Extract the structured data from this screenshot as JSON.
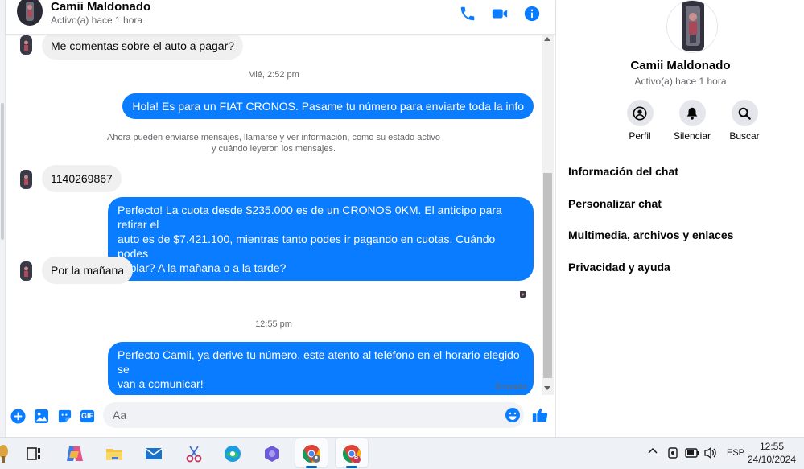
{
  "header": {
    "contact_name": "Camii Maldonado",
    "status": "Activo(a) hace 1 hora",
    "icons": [
      "phone-icon",
      "video-icon",
      "info-icon"
    ]
  },
  "messages": [
    {
      "direction": "in",
      "text": "Me comentas sobre el auto a pagar?"
    },
    {
      "type": "timestamp",
      "text": "Mié, 2:52 pm"
    },
    {
      "direction": "out",
      "text": "Hola! Es para un FIAT CRONOS. Pasame tu número para enviarte toda la info"
    },
    {
      "type": "system",
      "line1": "Ahora pueden enviarse mensajes, llamarse y ver información, como su estado activo",
      "line2": "y cuándo leyeron los mensajes."
    },
    {
      "direction": "in",
      "text": "1140269867"
    },
    {
      "direction": "out",
      "line1": "Perfecto! La cuota desde $235.000 es de un CRONOS 0KM. El anticipo para retirar el",
      "line2": "auto es de $7.421.100, mientras tanto podes ir pagando en cuotas. Cuándo podes",
      "line3": "hablar? A la mañana o a la tarde?"
    },
    {
      "direction": "in",
      "text": "Por la mañana"
    },
    {
      "type": "timestamp",
      "text": "12:55 pm"
    },
    {
      "direction": "out",
      "line1": "Perfecto Camii, ya derive tu número, este atento al teléfono en el horario elegido se",
      "line2": "van a comunicar!"
    }
  ],
  "sent_label": "Enviado",
  "composer": {
    "placeholder": "Aa",
    "value": "",
    "icons": [
      "plus-icon",
      "image-icon",
      "sticker-icon",
      "gif-icon",
      "emoji-icon",
      "like-icon"
    ],
    "gif_label": "GIF"
  },
  "info_panel": {
    "name": "Camii Maldonado",
    "status": "Activo(a) hace 1 hora",
    "actions": [
      {
        "label": "Perfil",
        "icon": "profile-icon"
      },
      {
        "label": "Silenciar",
        "icon": "bell-icon"
      },
      {
        "label": "Buscar",
        "icon": "search-icon"
      }
    ],
    "menu": [
      {
        "label": "Información del chat"
      },
      {
        "label": "Personalizar chat"
      },
      {
        "label": "Multimedia, archivos y enlaces"
      },
      {
        "label": "Privacidad y ayuda"
      }
    ]
  },
  "taskbar": {
    "apps": [
      "weather-icon",
      "task-view-icon",
      "copilot-icon",
      "file-explorer-icon",
      "mail-icon",
      "snipping-tool-icon",
      "edge-icon",
      "teams-icon",
      "chrome-profile-icon",
      "chrome-icon"
    ],
    "language": "ESP",
    "time": "12:55",
    "date": "24/10/2024",
    "chrome_badge": "B"
  },
  "colors": {
    "accent": "#0a7cff",
    "incoming_bubble": "#f0f0f0",
    "secondary_text": "#65676b"
  }
}
